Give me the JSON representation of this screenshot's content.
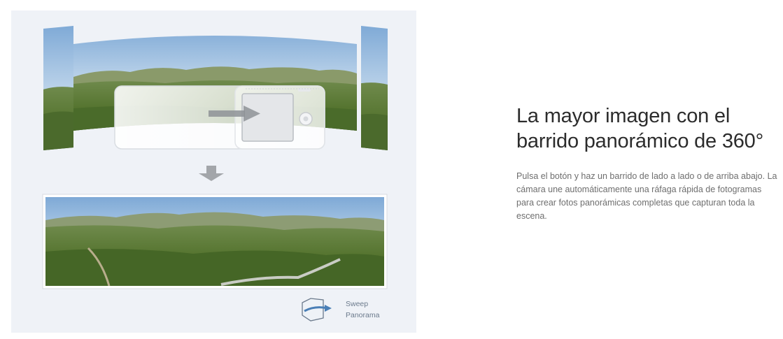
{
  "feature": {
    "headline": "La mayor imagen con el barrido panorámico de 360°",
    "description": "Pulsa el botón y haz un barrido de lado a lado o de arriba abajo. La cámara une automáticamente una ráfaga rápida de fotogramas para crear fotos panorámicas completas que capturan toda la escena."
  },
  "illustration": {
    "logo": {
      "line1": "Sweep",
      "line2": "Panorama"
    }
  },
  "colors": {
    "panel_background": "#eff2f7",
    "headline_text": "#2c2c2c",
    "body_text": "#6e6e6e",
    "arrow_gray": "#a3a6aa",
    "logo_blue": "#4a7fb6"
  },
  "icons": [
    "sweep-arrow-icon",
    "down-arrow-icon",
    "sweep-panorama-logo-icon",
    "camera-icon"
  ]
}
